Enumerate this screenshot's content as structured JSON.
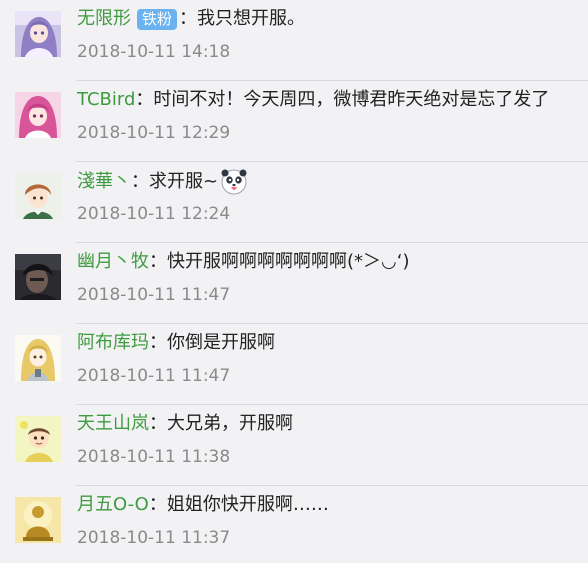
{
  "comments": [
    {
      "username": "无限形",
      "badge": "铁粉",
      "colon": "：",
      "text": "我只想开服。",
      "time": "2018-10-11 14:18",
      "avatar_icon": "anime-girl-purple-avatar"
    },
    {
      "username": "TCBird",
      "colon": "：",
      "text": "时间不对！今天周四，微博君昨天绝对是忘了发了",
      "time": "2018-10-11 12:29",
      "avatar_icon": "anime-girl-pink-avatar"
    },
    {
      "username": "淺華丶",
      "colon": "：",
      "text": "求开服~",
      "time": "2018-10-11 12:24",
      "avatar_icon": "anime-boy-brown-avatar",
      "emoji_icon": "panda-tongue-emoji"
    },
    {
      "username": "幽月丶牧",
      "colon": "：",
      "text": "快开服啊啊啊啊啊啊啊(*＞◡‘)",
      "time": "2018-10-11 11:47",
      "avatar_icon": "dark-photo-avatar"
    },
    {
      "username": "阿布库玛",
      "colon": "：",
      "text": "你倒是开服啊",
      "time": "2018-10-11 11:47",
      "avatar_icon": "anime-blonde-avatar"
    },
    {
      "username": "天王山岚",
      "colon": "：",
      "text": "大兄弟，开服啊",
      "time": "2018-10-11 11:38",
      "avatar_icon": "cartoon-kid-avatar"
    },
    {
      "username": "月五O-O",
      "colon": "：",
      "text": "姐姐你快开服啊……",
      "time": "2018-10-11 11:37",
      "avatar_icon": "golden-figure-avatar"
    }
  ],
  "colors": {
    "username": "#3f9b3f",
    "badge_bg": "#6ab3f0",
    "time": "#8a8a8a",
    "background": "#f2f2f4"
  }
}
